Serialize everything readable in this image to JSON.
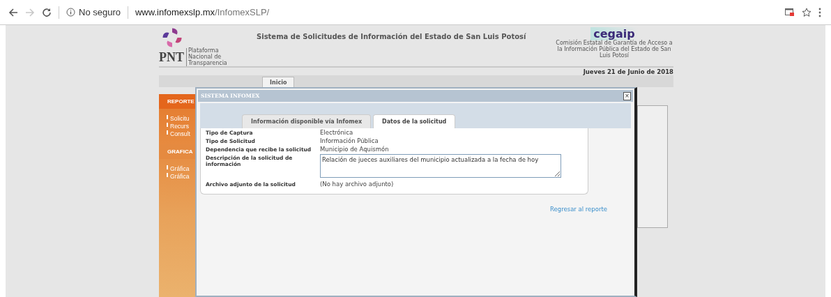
{
  "browser": {
    "security": "No seguro",
    "url_host": "www.infomexslp.mx",
    "url_path": "/InfomexSLP/",
    "forward_disabled": true
  },
  "header": {
    "logo_text": "PNT",
    "logo_subtitle": "Plataforma Nacional de Transparencia",
    "title": "Sistema de Solicitudes de Información del Estado de San Luis Potosí",
    "right_logo_text": "cegaip",
    "right_logo_subtitle": "Comisión Estatal de Garantía de Acceso a la Información Pública del Estado de San Luis Potosí",
    "date": "Jueves 21 de Junio de 2018"
  },
  "nav": {
    "tabs": [
      {
        "label": "Inicio",
        "selected": true
      }
    ]
  },
  "sidebar": {
    "sections": [
      {
        "title": "REPORTE",
        "kind": "dark",
        "items": [
          "Solicitu",
          "Recurs",
          "Consult"
        ]
      },
      {
        "title": "GRAFICA",
        "kind": "light",
        "items": [
          "Gráfica",
          "Gráfica"
        ]
      }
    ]
  },
  "modal": {
    "title": "SISTEMA INFOMEX",
    "close": "×",
    "tabs": [
      {
        "label": "Información disponible vía Infomex",
        "selected": false
      },
      {
        "label": "Datos de la solicitud",
        "selected": true
      }
    ],
    "fields": [
      {
        "label": "Tipo de Captura",
        "value": "Electrónica",
        "kind": "text"
      },
      {
        "label": "Tipo de Solicitud",
        "value": "Información Pública",
        "kind": "text"
      },
      {
        "label": "Dependencia que recibe la solicitud",
        "value": "Municipio de Aquismón",
        "kind": "text"
      },
      {
        "label": "Descripción de la solicitud de información",
        "value": "Relación de jueces auxiliares del municipio actualizada a la fecha de hoy",
        "kind": "textarea"
      },
      {
        "label": "Archivo adjunto de la solicitud",
        "value": "(No hay archivo adjunto)",
        "kind": "text"
      }
    ],
    "link": "Regresar al reporte"
  }
}
